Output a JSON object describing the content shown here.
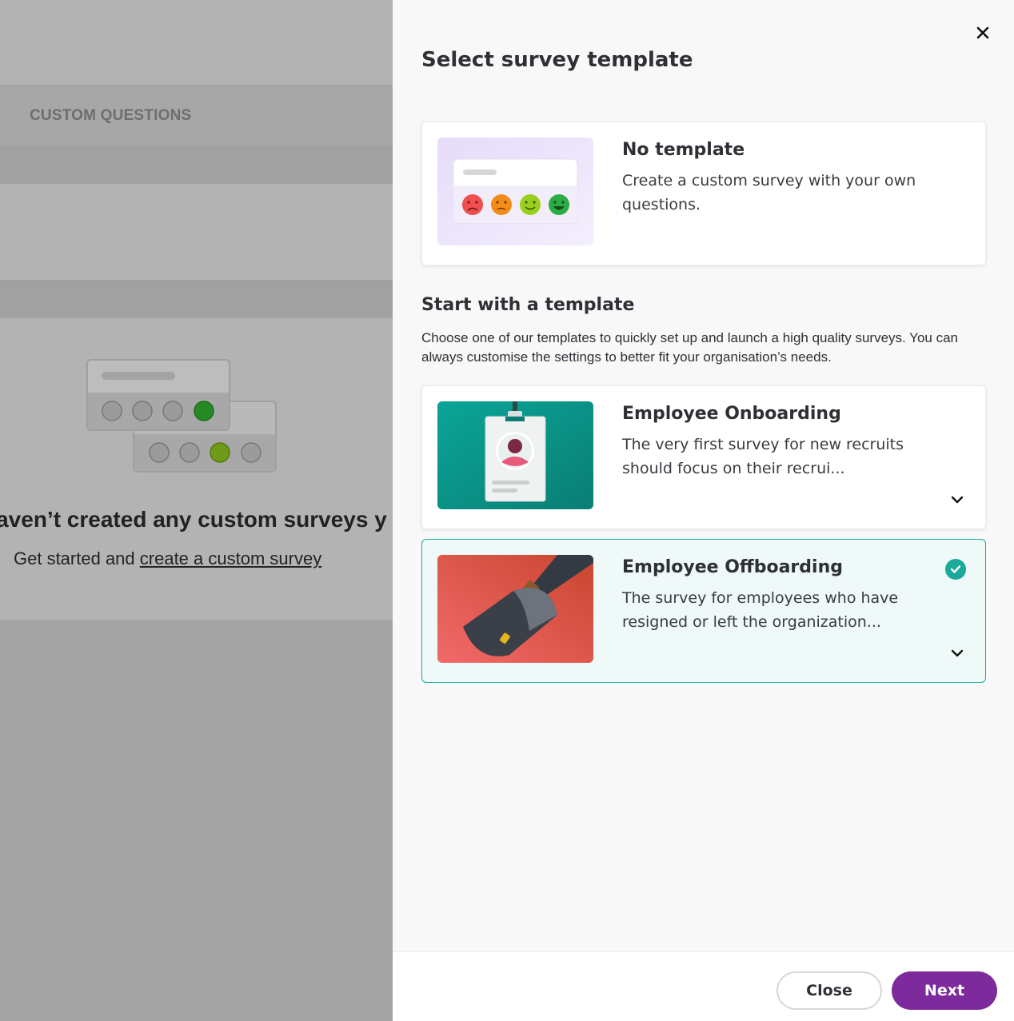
{
  "background": {
    "tab_label": "CUSTOM QUESTIONS",
    "empty_title": "haven’t created any custom surveys y",
    "empty_sub_prefix": "Get started and ",
    "empty_sub_link": "create a custom survey"
  },
  "drawer": {
    "title": "Select survey template",
    "no_template": {
      "title": "No template",
      "description": "Create a custom survey with your own questions."
    },
    "section": {
      "title": "Start with a template",
      "description": "Choose one of our templates to quickly set up and launch a high quality surveys. You can always customise the settings to better fit your organisation’s needs."
    },
    "templates": [
      {
        "title": "Employee Onboarding",
        "description": "The very first survey for new recruits should focus on their recrui...",
        "selected": false
      },
      {
        "title": "Employee Offboarding",
        "description": "The survey for employees who have resigned or left the organization...",
        "selected": true
      }
    ],
    "footer": {
      "close_label": "Close",
      "next_label": "Next"
    }
  },
  "icons": {
    "close": "close-icon",
    "chevron": "chevron-down-icon",
    "check": "check-circle-icon"
  },
  "colors": {
    "accent": "#7d2a9c",
    "selected_border": "#1aa99b",
    "selected_bg": "#eff9f8"
  }
}
